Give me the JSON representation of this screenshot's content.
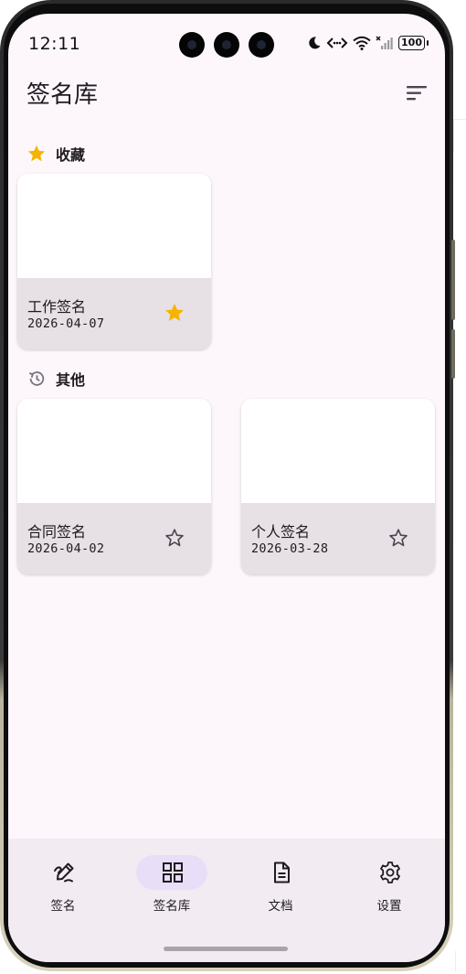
{
  "status_bar": {
    "time": "12:11",
    "battery": "100"
  },
  "app_bar": {
    "title": "签名库"
  },
  "sections": {
    "favorites": {
      "label": "收藏"
    },
    "others": {
      "label": "其他"
    }
  },
  "cards": [
    {
      "title": "工作签名",
      "date": "2026-04-07",
      "favorited": true
    },
    {
      "title": "合同签名",
      "date": "2026-04-02",
      "favorited": false
    },
    {
      "title": "个人签名",
      "date": "2026-03-28",
      "favorited": false
    }
  ],
  "bottom_nav": {
    "items": [
      {
        "label": "签名",
        "icon": "signature-icon",
        "active": false
      },
      {
        "label": "签名库",
        "icon": "grid-icon",
        "active": true
      },
      {
        "label": "文档",
        "icon": "document-icon",
        "active": false
      },
      {
        "label": "设置",
        "icon": "gear-icon",
        "active": false
      }
    ]
  },
  "colors": {
    "background": "#fdf7fc",
    "card_footer": "#e7e0e5",
    "star_filled": "#f4b400",
    "nav_indicator": "#e8def8",
    "nav_background": "#f2ecf2"
  }
}
